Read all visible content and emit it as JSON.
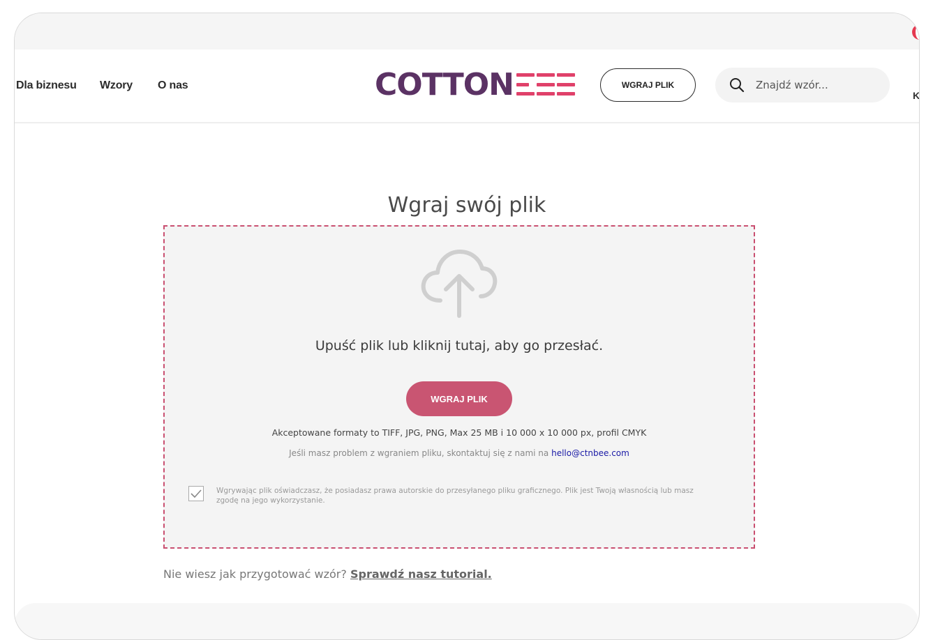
{
  "nav": {
    "links": [
      "Dla biznesu",
      "Wzory",
      "O nas"
    ],
    "logo_text": "COTTON",
    "logo_suffix": "BEE",
    "upload_button": "WGRAJ PLIK",
    "search_placeholder": "Znajdź wzór...",
    "cut_text": "K"
  },
  "colors": {
    "accent": "#c95572",
    "logo_purple": "#5b3264",
    "logo_pink": "#e0416a",
    "dashed_border": "#c94f70"
  },
  "upload": {
    "title": "Wgraj swój plik",
    "icon": "cloud-upload-icon",
    "drop_text": "Upuść plik lub kliknij tutaj, aby go przesłać.",
    "button": "WGRAJ PLIK",
    "formats": "Akceptowane formaty to TIFF, JPG, PNG, Max 25 MB i 10 000 x 10 000 px, profil CMYK",
    "help_prefix": "Jeśli masz problem z wgraniem pliku, skontaktuj się z nami na",
    "help_email": "hello@ctnbee.com",
    "consent_checked": true,
    "consent_line1": "Wgrywając plik oświadczasz, że posiadasz prawa autorskie do przesyłanego pliku graficznego. Plik jest Twoją własnością lub masz",
    "consent_line2": "zgodę na jego wykorzystanie."
  },
  "tutorial": {
    "question": "Nie wiesz jak przygotować wzór?",
    "link": "Sprawdź nasz tutorial."
  }
}
